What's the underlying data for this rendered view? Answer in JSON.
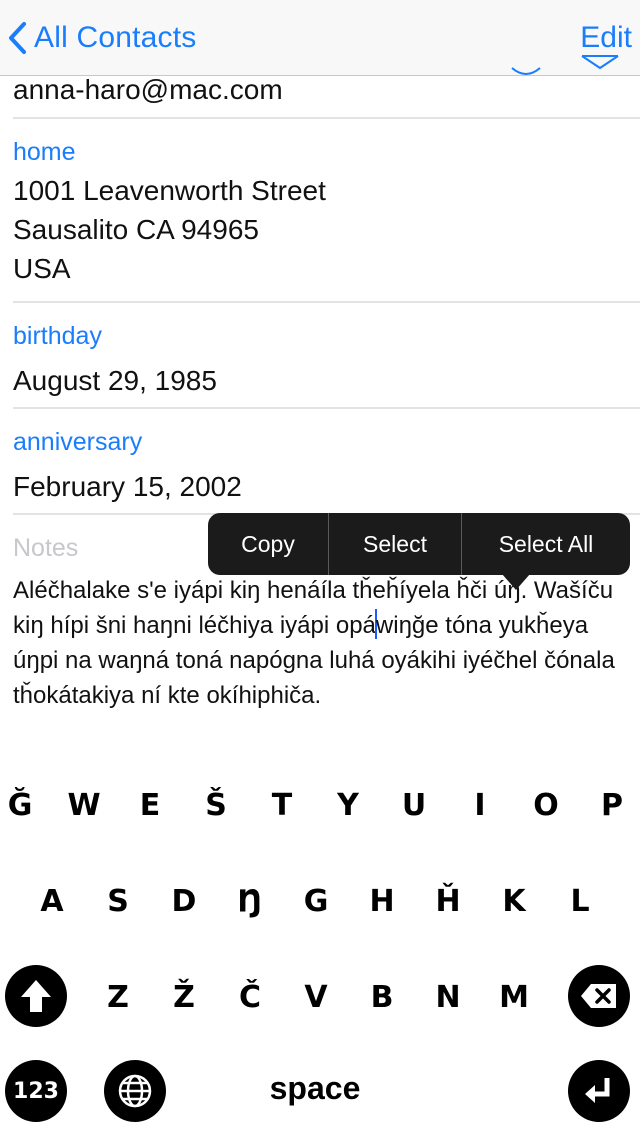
{
  "nav": {
    "back_label": "All Contacts",
    "edit_label": "Edit"
  },
  "contact": {
    "email": "anna-haro@mac.com",
    "address_label": "home",
    "address_lines": [
      "1001  Leavenworth Street",
      "Sausalito CA 94965",
      "USA"
    ],
    "birthday_label": "birthday",
    "birthday": "August 29, 1985",
    "anniversary_label": "anniversary",
    "anniversary": "February 15, 2002",
    "notes_label": "Notes",
    "notes_before_cursor": "Aléčhalake s'e iyápi kiŋ henáíla tȟeȟíyela ȟči úŋ. Wašíču kiŋ hípi šni haŋni léčhiya iyápi opá",
    "notes_after_cursor": "wiŋğe tóna yukȟeya úŋpi na waŋná toná napógna luhá oyákihi iyéčhel čónala tȟokátakiya ní kte okíhiphiča."
  },
  "menu": {
    "items": [
      "Copy",
      "Select",
      "Select All"
    ]
  },
  "keyboard": {
    "row1": [
      "Ğ",
      "W",
      "E",
      "Š",
      "T",
      "Y",
      "U",
      "I",
      "O",
      "P"
    ],
    "row2": [
      "A",
      "S",
      "D",
      "Ŋ",
      "G",
      "H",
      "Ȟ",
      "K",
      "L"
    ],
    "row3": [
      "Z",
      "Ž",
      "Č",
      "V",
      "B",
      "N",
      "M"
    ],
    "numbers_label": "123",
    "space_label": "space",
    "shift_icon": "shift-icon",
    "delete_icon": "delete-icon",
    "globe_icon": "globe-icon",
    "return_icon": "return-icon"
  },
  "colors": {
    "accent": "#1a7dfb",
    "separator": "#e3e3e6",
    "menu_bg": "#1b1b1b",
    "placeholder": "#c7c7cc"
  }
}
